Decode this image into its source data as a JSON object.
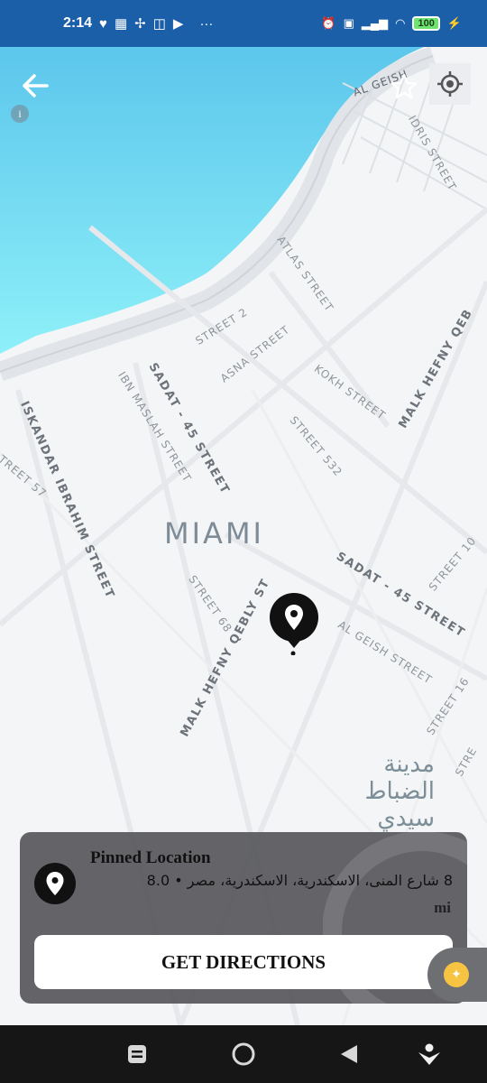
{
  "status_bar": {
    "time": "2:14",
    "left_icons": [
      "chat-icon",
      "sim-icon",
      "fan-icon",
      "cast-icon",
      "youtube-icon"
    ],
    "more": "···",
    "right_icons": [
      "alarm-icon",
      "volte-icon",
      "signal-icon",
      "wifi-icon"
    ],
    "battery": "100"
  },
  "map": {
    "area_label": "MIAMI",
    "arabic_label": "مدينة الضباط سيدي",
    "streets": {
      "al_geish_top": "AL GEISH",
      "idris": "IDRIS STREET",
      "atlas": "ATLAS STREET",
      "street2": "STREET 2",
      "asna": "ASNA STREET",
      "kokh": "KOKH STREET",
      "street532": "STREET 532",
      "malk_hefny_right": "MALK HEFNY QEB",
      "sadat_top": "SADAT - 45 STREET",
      "ibn_maslah": "IBN MASLAH STREET",
      "iskandar": "ISKANDAR IBRAHIM STREET",
      "street57": "TREET 57",
      "street68": "STREET 68",
      "malk_hefny_center": "MALK HEFNY QEBLY ST",
      "sadat_bottom": "SADAT - 45 STREET",
      "street10": "STREET 10",
      "al_geish_bottom": "AL GEISH STREET",
      "street16": "STREET 16",
      "street_edge": "STRE"
    },
    "water_color": "#7ddff2"
  },
  "bottom_sheet": {
    "title": "Pinned Location",
    "address": "8 شارع المنى، الاسكندرية، الاسكندرية، مصر • 8.0",
    "distance_unit": "mi",
    "button_label": "GET DIRECTIONS"
  },
  "nav_bar": {
    "icons": [
      "recents-icon",
      "home-icon",
      "back-icon",
      "accessibility-icon"
    ]
  }
}
